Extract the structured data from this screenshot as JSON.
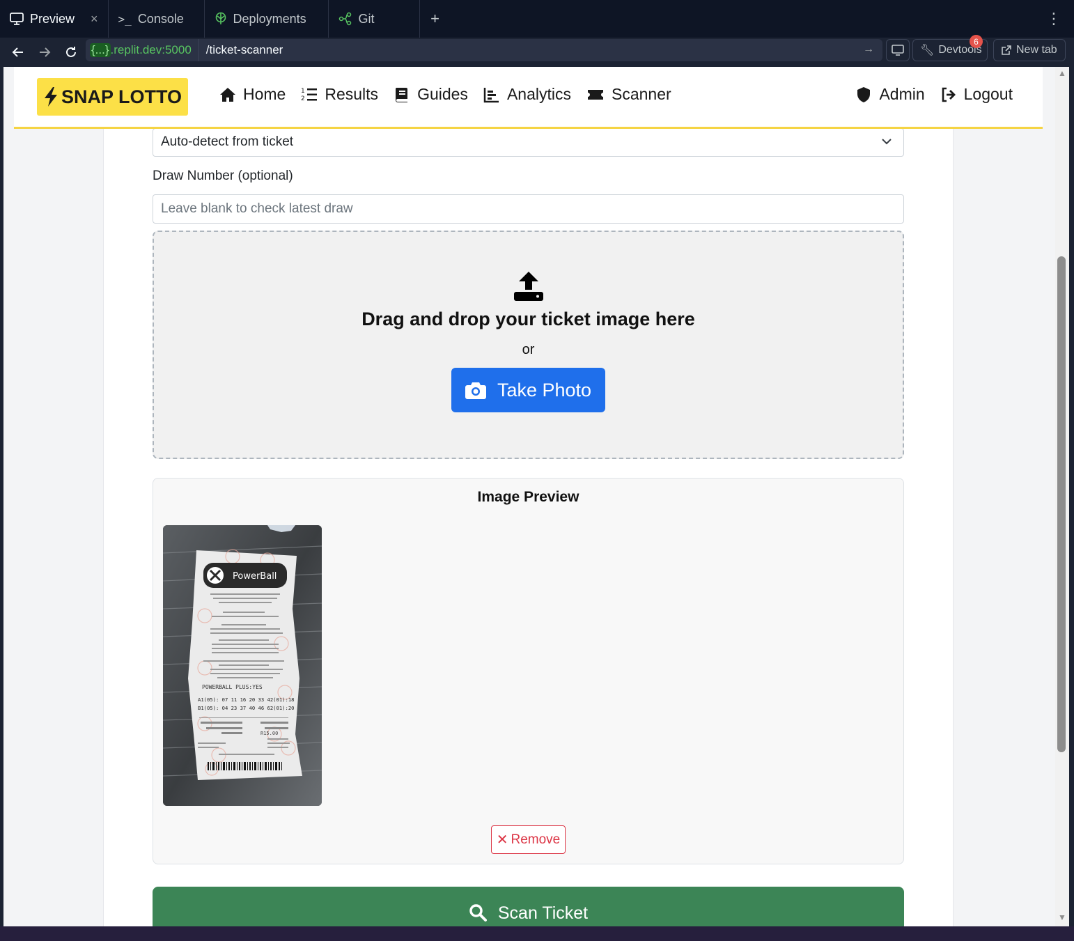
{
  "workspace_tabs": [
    {
      "label": "Preview",
      "icon": "monitor-icon",
      "active": true
    },
    {
      "label": "Console",
      "icon": "terminal-icon",
      "active": false
    },
    {
      "label": "Deployments",
      "icon": "deploy-icon",
      "active": false
    },
    {
      "label": "Git",
      "icon": "git-icon",
      "active": false
    }
  ],
  "address": {
    "brace": "{...}",
    "host": ".replit.dev:5000",
    "path": "/ticket-scanner"
  },
  "toolbar": {
    "devtools_label": "Devtools",
    "devtools_badge": "6",
    "newtab_label": "New tab"
  },
  "brand": {
    "label": "SNAP LOTTO",
    "color": "#fce047"
  },
  "nav": {
    "home": "Home",
    "results": "Results",
    "guides": "Guides",
    "analytics": "Analytics",
    "scanner": "Scanner",
    "admin": "Admin",
    "logout": "Logout"
  },
  "form": {
    "game_select_value": "Auto-detect from ticket",
    "draw_label": "Draw Number (optional)",
    "draw_placeholder": "Leave blank to check latest draw"
  },
  "dropzone": {
    "title": "Drag and drop your ticket image here",
    "or": "or",
    "take_photo": "Take Photo"
  },
  "preview": {
    "title": "Image Preview",
    "remove": "Remove",
    "ticket": {
      "brand": "PowerBall",
      "line_a": "A1(05): 07 11 16 20 33 42(01):18",
      "line_b": "B1(05): 04 23 37 40 46 62(01):20",
      "plus": "POWERBALL PLUS:YES",
      "total": "R15.00"
    }
  },
  "scan": {
    "label": "Scan Ticket",
    "color": "#3c8556"
  }
}
